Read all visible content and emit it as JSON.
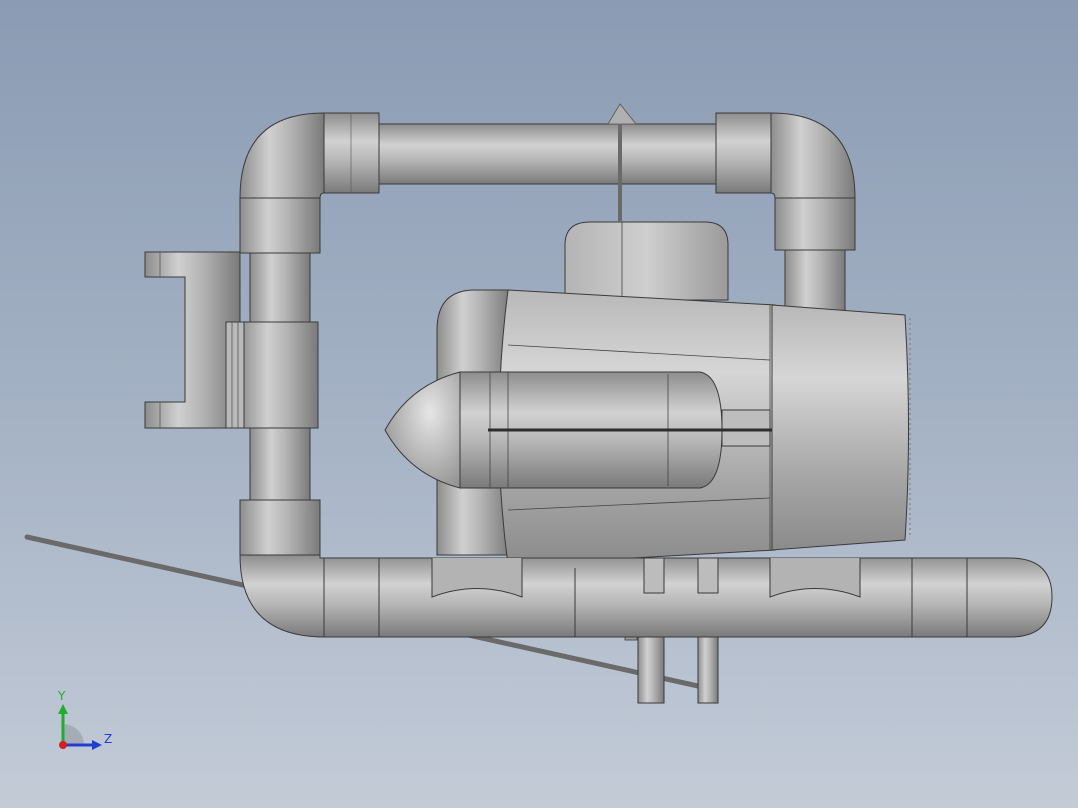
{
  "viewport": {
    "background_top": "#8a9bb3",
    "background_bottom": "#c3cbd7",
    "model_color": "#a9a9a9"
  },
  "triad": {
    "y_label": "Y",
    "z_label": "Z",
    "y_color": "#1fae28",
    "z_color": "#1f3fd0",
    "x_color": "#d42020"
  }
}
